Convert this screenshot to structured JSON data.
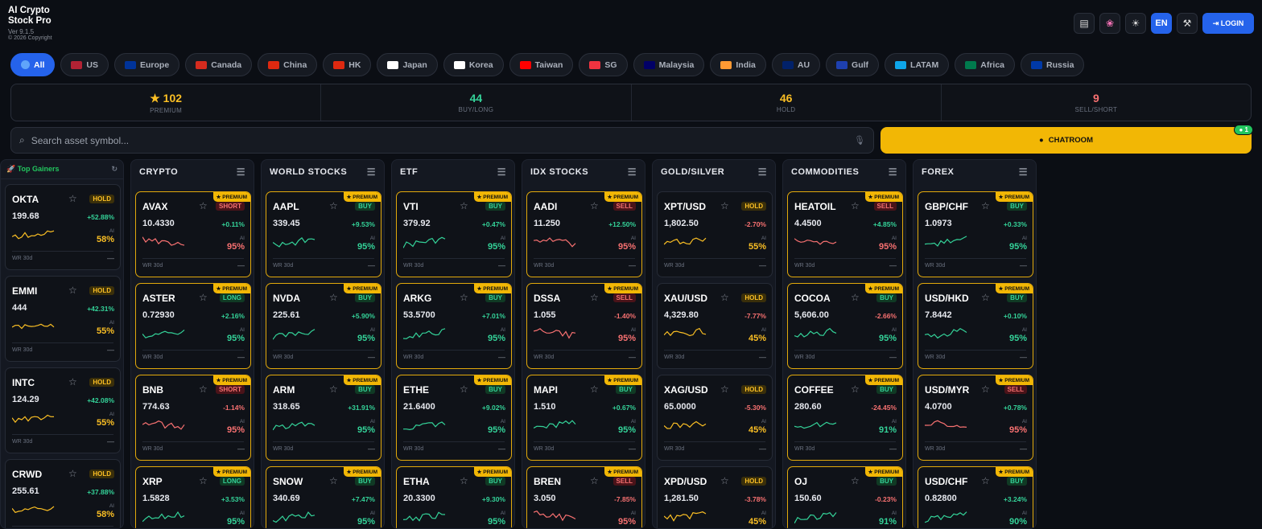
{
  "app": {
    "title": "AI Crypto Stock Pro",
    "version": "Ver 9.1.5",
    "copyright": "© 2026 Copyright"
  },
  "header": {
    "lang": "EN",
    "login": "LOGIN"
  },
  "regions": [
    "All",
    "US",
    "Europe",
    "Canada",
    "China",
    "HK",
    "Japan",
    "Korea",
    "Taiwan",
    "SG",
    "Malaysia",
    "India",
    "AU",
    "Gulf",
    "LATAM",
    "Africa",
    "Russia"
  ],
  "stats": [
    {
      "value": "★ 102",
      "label": "PREMIUM",
      "color": "#fbbf24"
    },
    {
      "value": "44",
      "label": "BUY/LONG",
      "color": "#34d399"
    },
    {
      "value": "46",
      "label": "HOLD",
      "color": "#fbbf24"
    },
    {
      "value": "9",
      "label": "SELL/SHORT",
      "color": "#f87171"
    }
  ],
  "search": {
    "placeholder": "Search asset symbol..."
  },
  "chatroom": {
    "label": "CHATROOM",
    "badge": "1"
  },
  "gainers": {
    "title": "🚀 Top Gainers",
    "items": [
      {
        "sym": "OKTA",
        "sig": "HOLD",
        "price": "199.68",
        "chg": "+52.88%",
        "pct": "58%",
        "trend": "mid"
      },
      {
        "sym": "EMMI",
        "sig": "HOLD",
        "price": "444",
        "chg": "+42.31%",
        "pct": "55%",
        "trend": "mid"
      },
      {
        "sym": "INTC",
        "sig": "HOLD",
        "price": "124.29",
        "chg": "+42.08%",
        "pct": "55%",
        "trend": "mid"
      },
      {
        "sym": "CRWD",
        "sig": "HOLD",
        "price": "255.61",
        "chg": "+37.88%",
        "pct": "58%",
        "trend": "mid"
      }
    ]
  },
  "columns": [
    {
      "title": "CRYPTO",
      "cards": [
        {
          "sym": "AVAX",
          "sig": "SHORT",
          "price": "10.4330",
          "chg": "+0.11%",
          "pct": "95%",
          "trend": "dn",
          "prem": true
        },
        {
          "sym": "ASTER",
          "sig": "LONG",
          "price": "0.72930",
          "chg": "+2.16%",
          "pct": "95%",
          "trend": "up",
          "prem": true
        },
        {
          "sym": "BNB",
          "sig": "SHORT",
          "price": "774.63",
          "chg": "-1.14%",
          "pct": "95%",
          "trend": "dn",
          "prem": true
        },
        {
          "sym": "XRP",
          "sig": "LONG",
          "price": "1.5828",
          "chg": "+3.53%",
          "pct": "95%",
          "trend": "up",
          "prem": true
        }
      ]
    },
    {
      "title": "WORLD STOCKS",
      "cards": [
        {
          "sym": "AAPL",
          "sig": "BUY",
          "price": "339.45",
          "chg": "+9.53%",
          "pct": "95%",
          "trend": "up",
          "prem": true
        },
        {
          "sym": "NVDA",
          "sig": "BUY",
          "price": "225.61",
          "chg": "+5.90%",
          "pct": "95%",
          "trend": "up",
          "prem": true
        },
        {
          "sym": "ARM",
          "sig": "BUY",
          "price": "318.65",
          "chg": "+31.91%",
          "pct": "95%",
          "trend": "up",
          "prem": true
        },
        {
          "sym": "SNOW",
          "sig": "BUY",
          "price": "340.69",
          "chg": "+7.47%",
          "pct": "95%",
          "trend": "up",
          "prem": true
        }
      ]
    },
    {
      "title": "ETF",
      "cards": [
        {
          "sym": "VTI",
          "sig": "BUY",
          "price": "379.92",
          "chg": "+0.47%",
          "pct": "95%",
          "trend": "up",
          "prem": true
        },
        {
          "sym": "ARKG",
          "sig": "BUY",
          "price": "53.5700",
          "chg": "+7.01%",
          "pct": "95%",
          "trend": "up",
          "prem": true
        },
        {
          "sym": "ETHE",
          "sig": "BUY",
          "price": "21.6400",
          "chg": "+9.02%",
          "pct": "95%",
          "trend": "up",
          "prem": true
        },
        {
          "sym": "ETHA",
          "sig": "BUY",
          "price": "20.3300",
          "chg": "+9.30%",
          "pct": "95%",
          "trend": "up",
          "prem": true
        }
      ]
    },
    {
      "title": "IDX STOCKS",
      "cards": [
        {
          "sym": "AADI",
          "sig": "SELL",
          "price": "11.250",
          "chg": "+12.50%",
          "pct": "95%",
          "trend": "dn",
          "prem": true
        },
        {
          "sym": "DSSA",
          "sig": "SELL",
          "price": "1.055",
          "chg": "-1.40%",
          "pct": "95%",
          "trend": "dn",
          "prem": true
        },
        {
          "sym": "MAPI",
          "sig": "BUY",
          "price": "1.510",
          "chg": "+0.67%",
          "pct": "95%",
          "trend": "up",
          "prem": true
        },
        {
          "sym": "BREN",
          "sig": "SELL",
          "price": "3.050",
          "chg": "-7.85%",
          "pct": "95%",
          "trend": "dn",
          "prem": true
        }
      ]
    },
    {
      "title": "GOLD/SILVER",
      "cards": [
        {
          "sym": "XPT/USD",
          "sig": "HOLD",
          "price": "1,802.50",
          "chg": "-2.70%",
          "pct": "55%",
          "trend": "mid",
          "prem": false
        },
        {
          "sym": "XAU/USD",
          "sig": "HOLD",
          "price": "4,329.80",
          "chg": "-7.77%",
          "pct": "45%",
          "trend": "mid",
          "prem": false
        },
        {
          "sym": "XAG/USD",
          "sig": "HOLD",
          "price": "65.0000",
          "chg": "-5.30%",
          "pct": "45%",
          "trend": "mid",
          "prem": false
        },
        {
          "sym": "XPD/USD",
          "sig": "HOLD",
          "price": "1,281.50",
          "chg": "-3.78%",
          "pct": "45%",
          "trend": "mid",
          "prem": false
        }
      ]
    },
    {
      "title": "COMMODITIES",
      "cards": [
        {
          "sym": "HEATOIL",
          "sig": "SELL",
          "price": "4.4500",
          "chg": "+4.85%",
          "pct": "95%",
          "trend": "dn",
          "prem": true
        },
        {
          "sym": "COCOA",
          "sig": "BUY",
          "price": "5,606.00",
          "chg": "-2.66%",
          "pct": "95%",
          "trend": "up",
          "prem": true
        },
        {
          "sym": "COFFEE",
          "sig": "BUY",
          "price": "280.60",
          "chg": "-24.45%",
          "pct": "91%",
          "trend": "up",
          "prem": true
        },
        {
          "sym": "OJ",
          "sig": "BUY",
          "price": "150.60",
          "chg": "-0.23%",
          "pct": "91%",
          "trend": "up",
          "prem": true
        }
      ]
    },
    {
      "title": "FOREX",
      "cards": [
        {
          "sym": "GBP/CHF",
          "sig": "BUY",
          "price": "1.0973",
          "chg": "+0.33%",
          "pct": "95%",
          "trend": "up",
          "prem": true
        },
        {
          "sym": "USD/HKD",
          "sig": "BUY",
          "price": "7.8442",
          "chg": "+0.10%",
          "pct": "95%",
          "trend": "up",
          "prem": true
        },
        {
          "sym": "USD/MYR",
          "sig": "SELL",
          "price": "4.0700",
          "chg": "+0.78%",
          "pct": "95%",
          "trend": "dn",
          "prem": true
        },
        {
          "sym": "USD/CHF",
          "sig": "BUY",
          "price": "0.82800",
          "chg": "+3.24%",
          "pct": "90%",
          "trend": "up",
          "prem": true
        }
      ]
    }
  ],
  "labels": {
    "premium": "★ PREMIUM",
    "ai": "AI",
    "wr": "WR 30d",
    "dash": "—"
  }
}
